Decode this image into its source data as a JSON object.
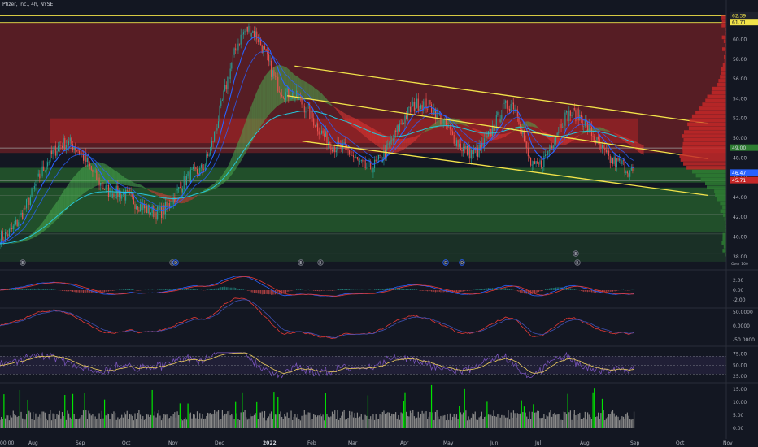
{
  "header": {
    "title": "Pfizer, Inc., 4h, NYSE"
  },
  "colors": {
    "background": "#131722",
    "up_candle": "#26a69a",
    "down_candle": "#ef5350",
    "channel": "#f2e34a",
    "resistance_zone": "#c62828",
    "support_zone": "#2e7d32",
    "ma_blue": "#2962ff",
    "ma_cyan": "#26c6da",
    "cloud_green": "#4caf50",
    "cloud_red": "#e53935",
    "osc_red": "#e53935",
    "osc_blue": "#3f51b5",
    "rsi_line": "#7e57c2",
    "rsi_signal": "#f0d060",
    "volume_gray": "#8a8a8a",
    "volume_green": "#00e600"
  },
  "price_axis": {
    "ticks": [
      "60.00",
      "58.00",
      "56.00",
      "54.00",
      "52.00",
      "50.00",
      "48.00",
      "46.00",
      "44.00",
      "42.00",
      "40.00",
      "38.00"
    ],
    "labels": {
      "top_level": "62.39",
      "second_level": "61.71",
      "mid_level": "49.00",
      "last_price": "46.47",
      "low_level": "45.71",
      "bottom_badge": "Over 100"
    }
  },
  "macd_axis": {
    "ticks": [
      "2.00",
      "0.00",
      "-2.00"
    ]
  },
  "osc_axis": {
    "ticks": [
      "50.0000",
      "0.0000",
      "-50.0000"
    ]
  },
  "rsi_axis": {
    "ticks": [
      "75.00",
      "50.00",
      "25.00"
    ]
  },
  "vol_axis": {
    "ticks": [
      "15.00",
      "10.00",
      "5.00",
      "0.00"
    ]
  },
  "time_axis": {
    "labels": [
      "00:00",
      "Aug",
      "Sep",
      "Oct",
      "Nov",
      "Dec",
      "2022",
      "Feb",
      "Mar",
      "Apr",
      "May",
      "Jun",
      "Jul",
      "Aug",
      "Sep",
      "Oct",
      "Nov"
    ]
  },
  "events": [
    "E",
    "E",
    "D",
    "E",
    "E",
    "D",
    "D",
    "E",
    "E"
  ],
  "chart_data": {
    "type": "candlestick",
    "title": "Pfizer, Inc., 4h, NYSE",
    "x_range": [
      "2021-07",
      "2022-11"
    ],
    "ylim": [
      37,
      63
    ],
    "price_path_approx": [
      {
        "x": "2021-07",
        "y": 40.0
      },
      {
        "x": "2021-08-15",
        "y": 49.5
      },
      {
        "x": "2021-09-15",
        "y": 44.5
      },
      {
        "x": "2021-10-15",
        "y": 42.5
      },
      {
        "x": "2021-11-10",
        "y": 46.5
      },
      {
        "x": "2021-12-15",
        "y": 61.0
      },
      {
        "x": "2022-01-10",
        "y": 54.5
      },
      {
        "x": "2022-02-15",
        "y": 49.0
      },
      {
        "x": "2022-03-05",
        "y": 47.0
      },
      {
        "x": "2022-04-10",
        "y": 53.5
      },
      {
        "x": "2022-05-15",
        "y": 48.5
      },
      {
        "x": "2022-06-10",
        "y": 53.5
      },
      {
        "x": "2022-06-25",
        "y": 47.0
      },
      {
        "x": "2022-07-20",
        "y": 52.5
      },
      {
        "x": "2022-08-20",
        "y": 47.5
      },
      {
        "x": "2022-08-31",
        "y": 46.5
      }
    ],
    "horizontal_levels": [
      62.39,
      61.71,
      49.0,
      45.71
    ],
    "zones": [
      {
        "kind": "resistance",
        "from": 48.5,
        "to": 61.7
      },
      {
        "kind": "resistance",
        "from": 49.5,
        "to": 52.0
      },
      {
        "kind": "support",
        "from": 45.5,
        "to": 47.0
      },
      {
        "kind": "support",
        "from": 40.5,
        "to": 45.0
      }
    ],
    "channel_lines": [
      {
        "name": "upper",
        "from": {
          "x": "2022-01-15",
          "y": 57.3
        },
        "to": {
          "x": "2022-10-20",
          "y": 51.5
        }
      },
      {
        "name": "middle",
        "from": {
          "x": "2022-01-10",
          "y": 54.3
        },
        "to": {
          "x": "2022-10-20",
          "y": 47.9
        }
      },
      {
        "name": "lower",
        "from": {
          "x": "2022-01-20",
          "y": 49.7
        },
        "to": {
          "x": "2022-10-20",
          "y": 44.2
        }
      }
    ]
  }
}
